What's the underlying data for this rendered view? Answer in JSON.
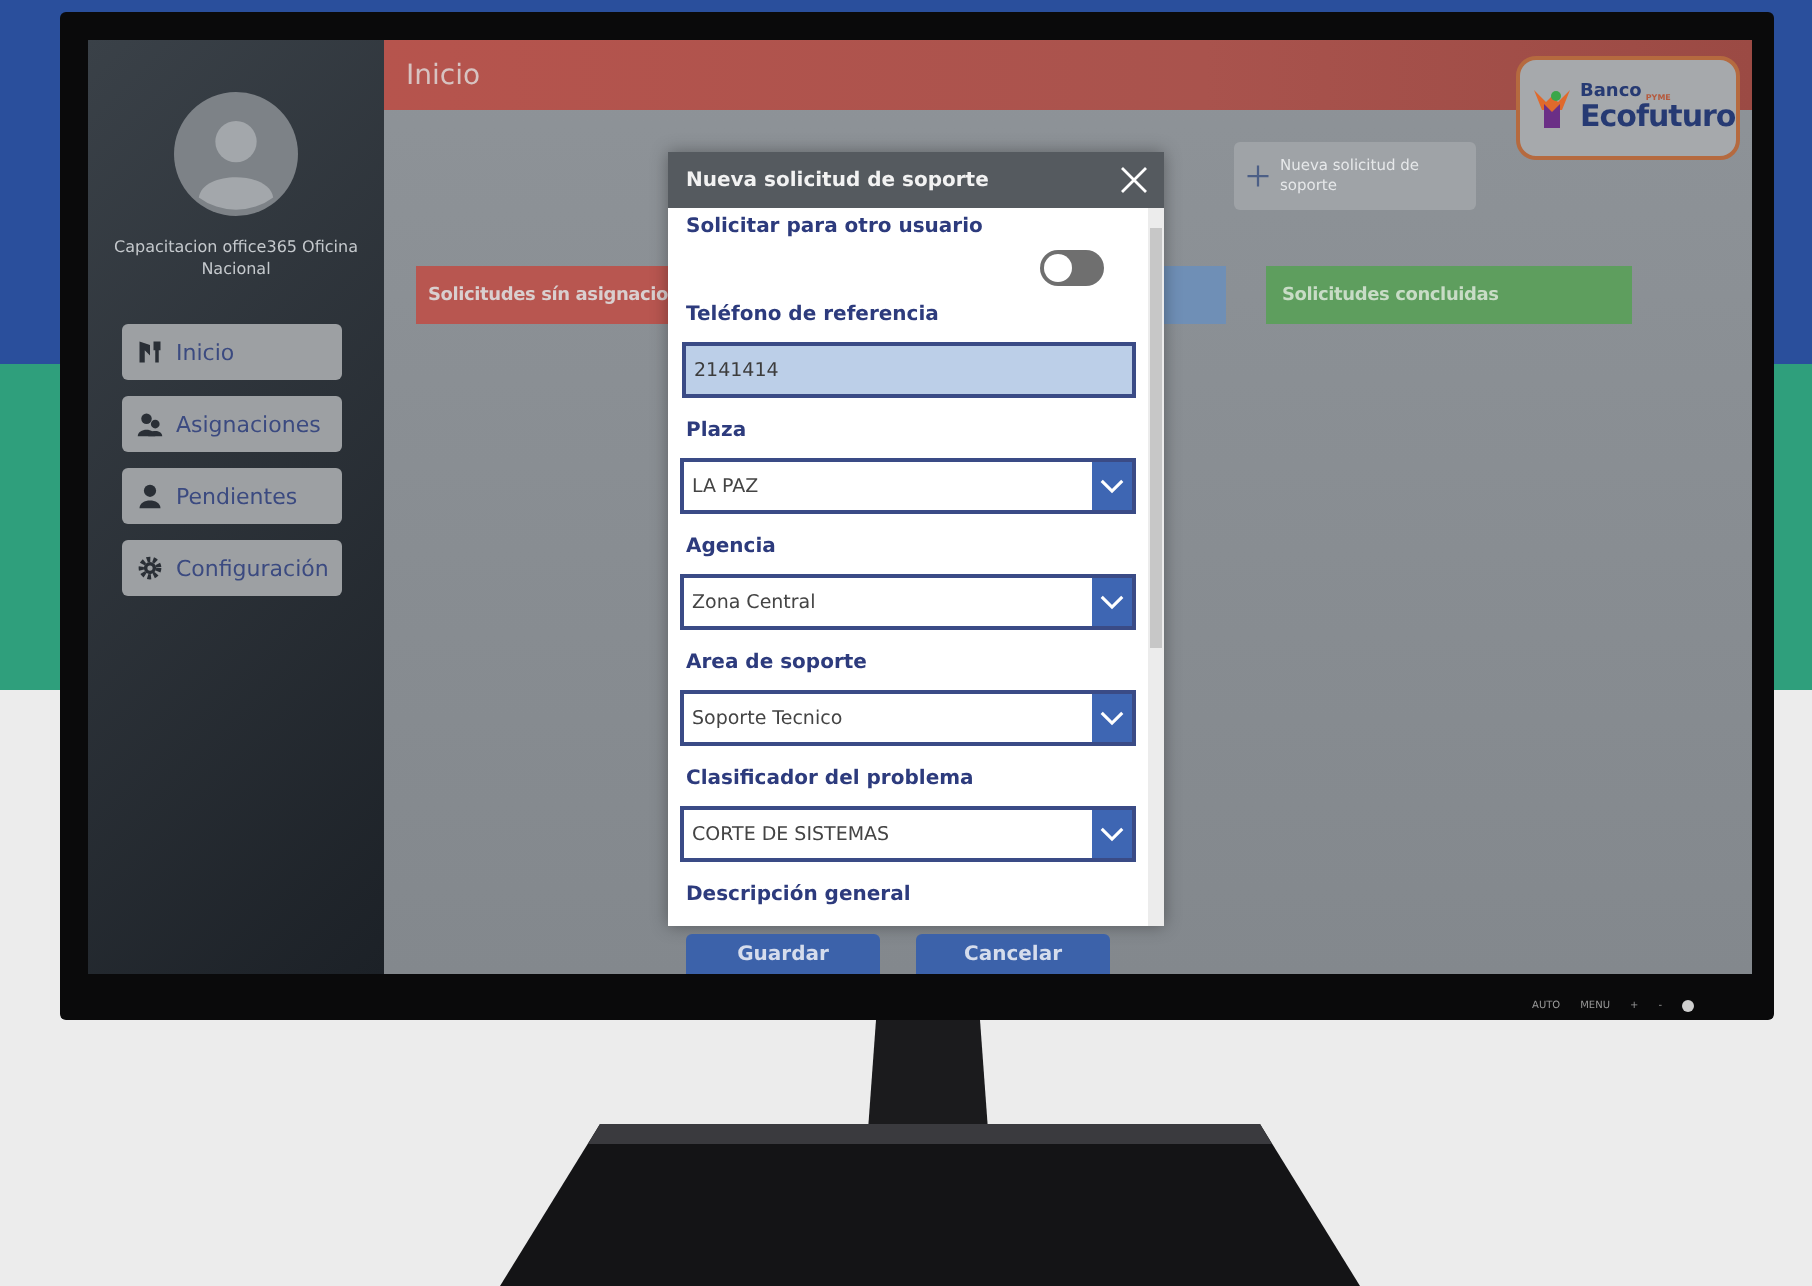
{
  "screen": {
    "sidebar": {
      "user_name": "Capacitacion office365 Oficina Nacional",
      "items": [
        {
          "label": "Inicio",
          "kind": "tools"
        },
        {
          "label": "Asignaciones",
          "kind": "people"
        },
        {
          "label": "Pendientes",
          "kind": "person"
        },
        {
          "label": "Configuración",
          "kind": "gear"
        }
      ]
    },
    "header": {
      "title": "Inicio"
    },
    "logo": {
      "line1": "Banco",
      "tag": "PYME",
      "line2": "Ecofuturo"
    },
    "new_request_button": {
      "label": "Nueva solicitud de soporte"
    },
    "panels": [
      {
        "title": "Solicitudes sín asignacio",
        "color": "#b85650"
      },
      {
        "color": "#6f8fb6"
      },
      {
        "title": "Solicitudes concluidas",
        "color": "#5e9e5e"
      }
    ],
    "modal": {
      "title": "Nueva solicitud de soporte",
      "fields": [
        {
          "kind": "toggle",
          "label": "Solicitar para otro usuario",
          "on": false
        },
        {
          "kind": "text",
          "label": "Teléfono de referencia",
          "value": "2141414"
        },
        {
          "kind": "dropdown",
          "label": "Plaza",
          "value": "LA PAZ"
        },
        {
          "kind": "dropdown",
          "label": "Agencia",
          "value": "Zona Central"
        },
        {
          "kind": "dropdown",
          "label": "Area de soporte",
          "value": "Soporte Tecnico"
        },
        {
          "kind": "dropdown",
          "label": "Clasificador del problema",
          "value": "CORTE DE SISTEMAS"
        },
        {
          "kind": "label",
          "label": "Descripción general"
        }
      ],
      "buttons": [
        "Guardar",
        "Cancelar"
      ]
    }
  },
  "monitor_controls": [
    "AUTO",
    "MENU",
    "+",
    "-"
  ]
}
